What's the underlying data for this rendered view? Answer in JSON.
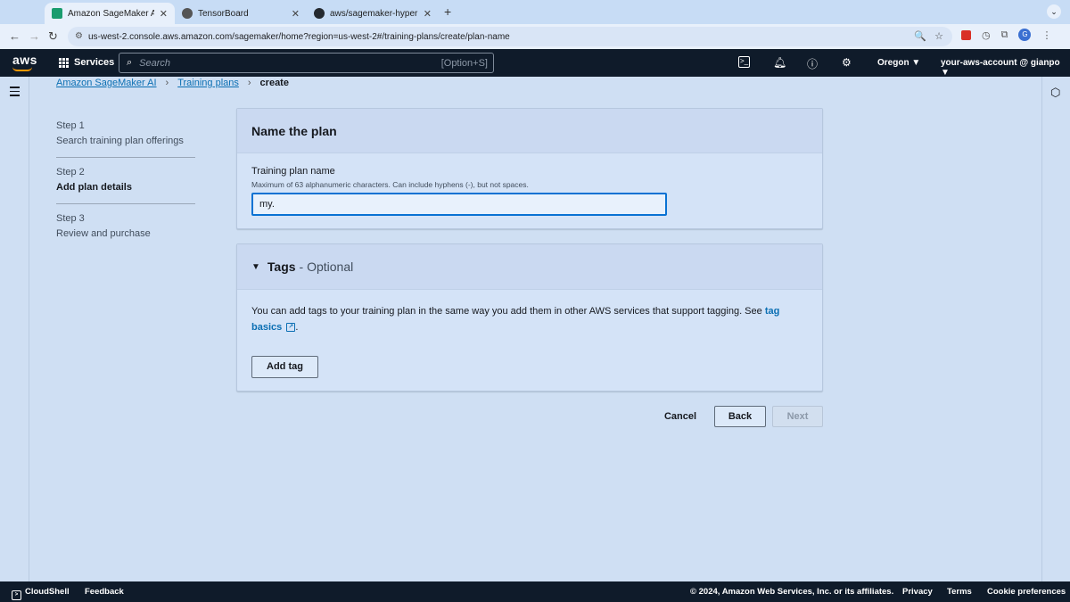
{
  "browser": {
    "tabs": [
      {
        "title": "Amazon SageMaker AI | us-we",
        "favicon_color": "#1a9c6e"
      },
      {
        "title": "TensorBoard",
        "favicon_color": "#555555"
      },
      {
        "title": "aws/sagemaker-hyperpod-re",
        "favicon_color": "#24292f"
      }
    ],
    "url": "us-west-2.console.aws.amazon.com/sagemaker/home?region=us-west-2#/training-plans/create/plan-name",
    "profile_initial": "G"
  },
  "aws_header": {
    "logo": "aws",
    "services_label": "Services",
    "search_placeholder": "Search",
    "search_shortcut": "[Option+S]",
    "region": "Oregon ▼",
    "account": "your-aws-account @ gianpo ▼"
  },
  "breadcrumb": {
    "items": [
      "Amazon SageMaker AI",
      "Training plans"
    ],
    "current": "create"
  },
  "steps": [
    {
      "num": "Step 1",
      "label": "Search training plan offerings",
      "active": false
    },
    {
      "num": "Step 2",
      "label": "Add plan details",
      "active": true
    },
    {
      "num": "Step 3",
      "label": "Review and purchase",
      "active": false
    }
  ],
  "plan_card": {
    "title": "Name the plan",
    "field_label": "Training plan name",
    "field_description": "Maximum of 63 alphanumeric characters. Can include hyphens (-), but not spaces.",
    "field_value": "my."
  },
  "tags_card": {
    "title": "Tags",
    "optional": "- Optional",
    "body_text": "You can add tags to your training plan in the same way you add them in other AWS services that support tagging. See",
    "link_text": "tag basics",
    "body_end": ".",
    "add_tag_label": "Add tag"
  },
  "actions": {
    "cancel": "Cancel",
    "back": "Back",
    "next": "Next"
  },
  "footer": {
    "cloudshell": "CloudShell",
    "feedback": "Feedback",
    "copyright": "© 2024, Amazon Web Services, Inc. or its affiliates.",
    "privacy": "Privacy",
    "terms": "Terms",
    "cookie": "Cookie preferences"
  }
}
